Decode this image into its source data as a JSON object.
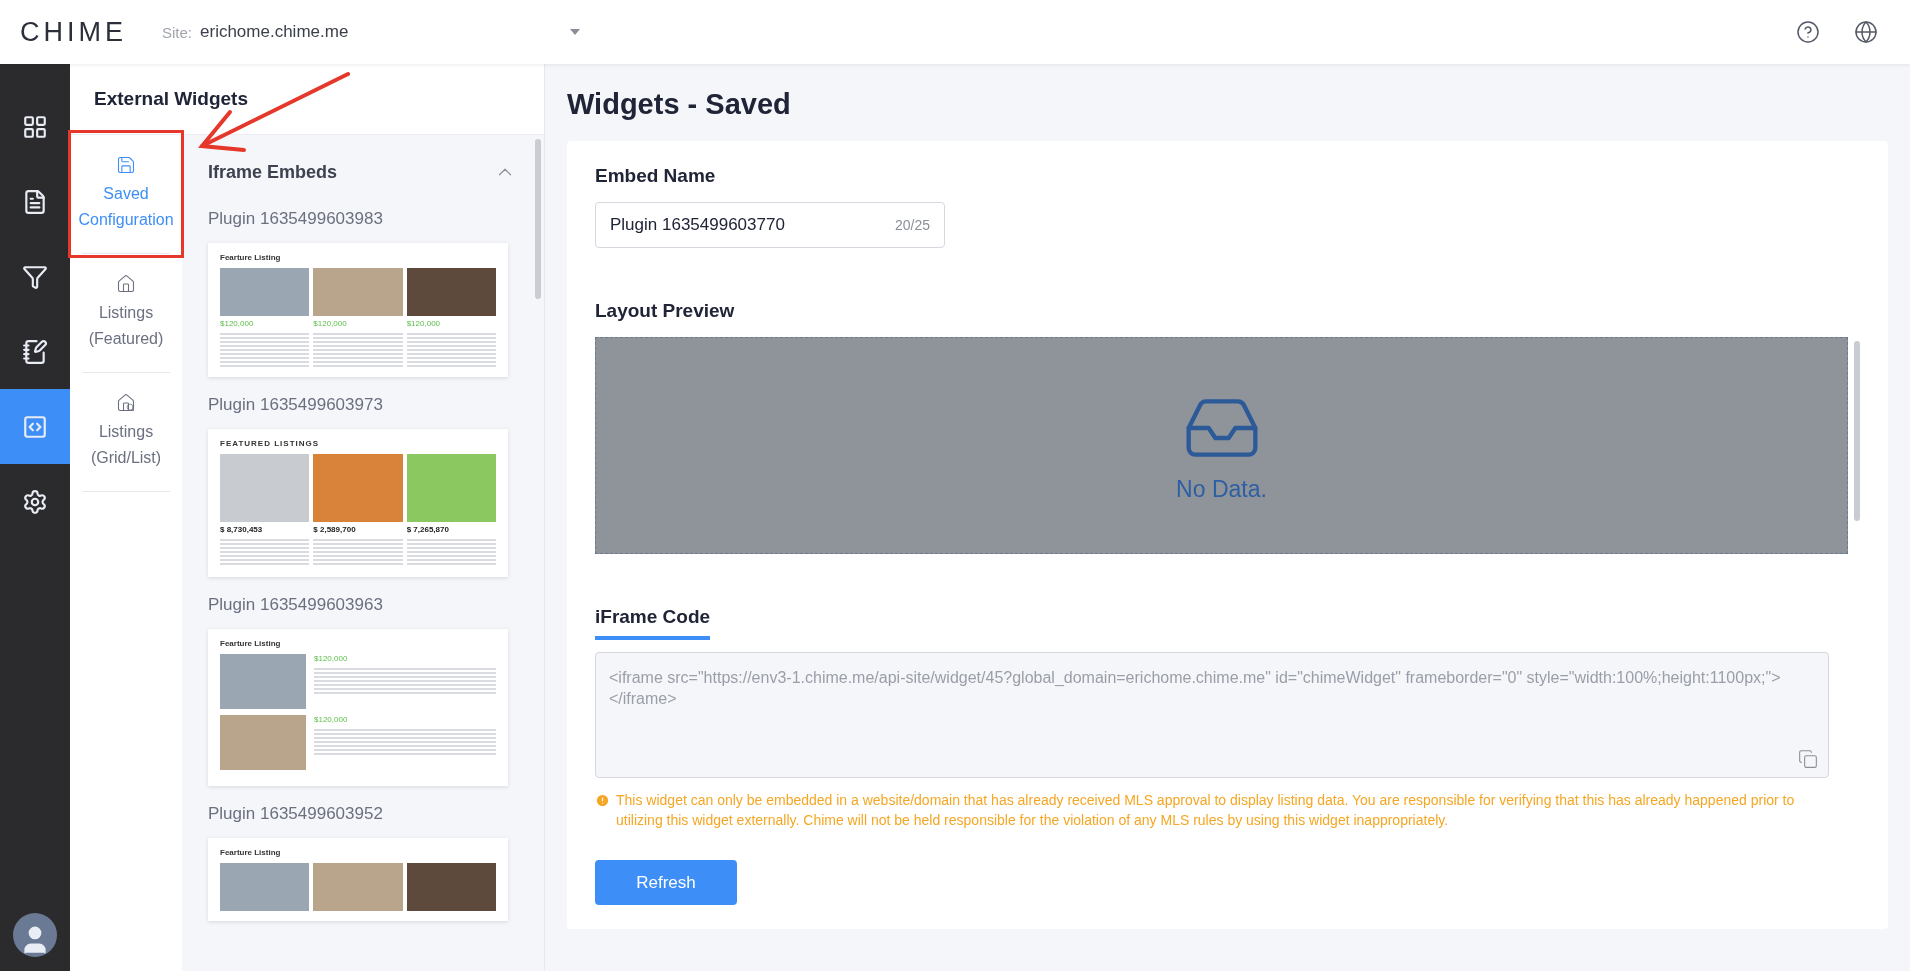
{
  "header": {
    "logo": "CHIME",
    "site_label": "Site:",
    "site_value": "erichome.chime.me"
  },
  "rail": [
    {
      "kind": "dashboard",
      "selected": false
    },
    {
      "kind": "document",
      "selected": false
    },
    {
      "kind": "filter",
      "selected": false
    },
    {
      "kind": "edit",
      "selected": false
    },
    {
      "kind": "code",
      "selected": true
    },
    {
      "kind": "settings",
      "selected": false
    }
  ],
  "panel": {
    "title": "External Widgets"
  },
  "subnav": [
    {
      "kind": "save",
      "label": "Saved Configuration",
      "selected": true
    },
    {
      "kind": "home-star",
      "label": "Listings (Featured)",
      "selected": false
    },
    {
      "kind": "home-search",
      "label": "Listings (Grid/List)",
      "selected": false
    }
  ],
  "section": {
    "title": "Iframe Embeds",
    "expanded": true
  },
  "plugins": [
    {
      "name": "Plugin 1635499603983",
      "preview": {
        "kind": "grid",
        "title": "Fearture Listing",
        "prices": [
          "$120,000",
          "$120,000",
          "$120,000"
        ]
      }
    },
    {
      "name": "Plugin 1635499603973",
      "preview": {
        "kind": "grid-dark",
        "title": "FEATURED LISTINGS",
        "prices": [
          "$ 8,730,453",
          "$ 2,589,700",
          "$ 7,265,870"
        ]
      }
    },
    {
      "name": "Plugin 1635499603963",
      "preview": {
        "kind": "list",
        "title": "Fearture Listing",
        "prices": [
          "$120,000",
          "$120,000"
        ]
      }
    },
    {
      "name": "Plugin 1635499603952",
      "preview": {
        "kind": "grid",
        "title": "Fearture Listing"
      }
    }
  ],
  "main": {
    "title": "Widgets - Saved",
    "embed_label": "Embed Name",
    "embed_value": "Plugin 1635499603770",
    "embed_count": "20/25",
    "preview_label": "Layout Preview",
    "empty_text": "No Data.",
    "code_tab": "iFrame Code",
    "code": "<iframe src=\"https://env3-1.chime.me/api-site/widget/45?global_domain=erichome.chime.me\" id=\"chimeWidget\" frameborder=\"0\" style=\"width:100%;height:1100px;\"></iframe>",
    "warning": "This widget can only be embedded in a website/domain that has already received MLS approval to display listing data. You are responsible for verifying that this has already happened prior to utilizing this widget externally. Chime will not be held responsible for the violation of any MLS rules by using this widget inappropriately.",
    "refresh": "Refresh"
  }
}
